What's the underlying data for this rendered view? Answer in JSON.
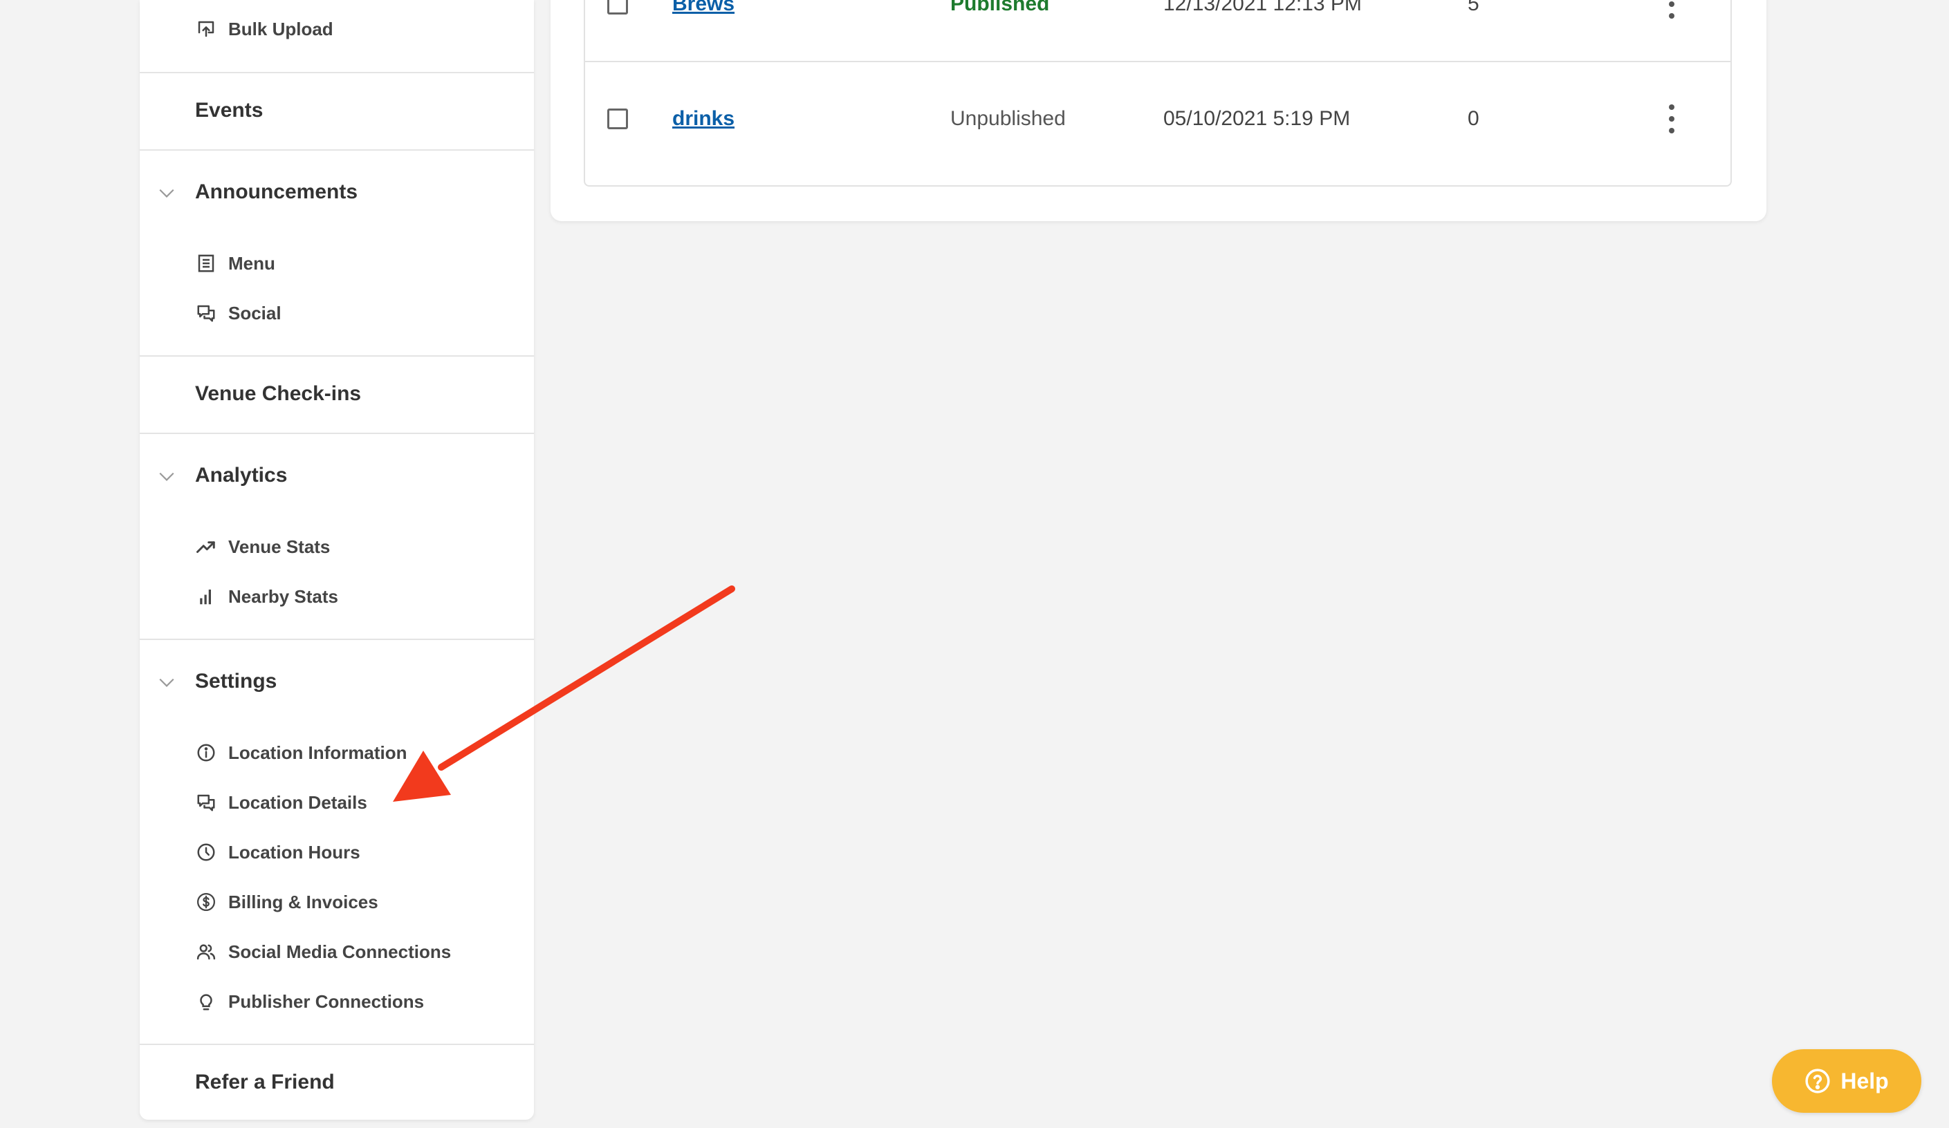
{
  "sidebar": {
    "bulk_upload": {
      "label": "Bulk Upload",
      "icon": "upload-icon"
    },
    "events": {
      "label": "Events"
    },
    "announcements": {
      "label": "Announcements",
      "items": [
        {
          "label": "Menu",
          "icon": "menu-list-icon"
        },
        {
          "label": "Social",
          "icon": "chat-icon"
        }
      ]
    },
    "venue_checkins": {
      "label": "Venue Check-ins"
    },
    "analytics": {
      "label": "Analytics",
      "items": [
        {
          "label": "Venue Stats",
          "icon": "trending-up-icon"
        },
        {
          "label": "Nearby Stats",
          "icon": "bar-chart-icon"
        }
      ]
    },
    "settings": {
      "label": "Settings",
      "items": [
        {
          "label": "Location Information",
          "icon": "info-icon"
        },
        {
          "label": "Location Details",
          "icon": "chat-icon"
        },
        {
          "label": "Location Hours",
          "icon": "clock-icon"
        },
        {
          "label": "Billing & Invoices",
          "icon": "dollar-icon"
        },
        {
          "label": "Social Media Connections",
          "icon": "users-icon"
        },
        {
          "label": "Publisher Connections",
          "icon": "lightbulb-icon"
        }
      ]
    },
    "refer": {
      "label": "Refer a Friend"
    }
  },
  "table": {
    "rows": [
      {
        "name": "Brews",
        "status": "Published",
        "date": "12/13/2021 12:13 PM",
        "count": "5"
      },
      {
        "name": "drinks",
        "status": "Unpublished",
        "date": "05/10/2021 5:19 PM",
        "count": "0"
      }
    ]
  },
  "help": {
    "label": "Help"
  },
  "colors": {
    "link": "#0b5fa8",
    "published": "#1e7b2e",
    "help_button": "#f7b730",
    "annotation_arrow": "#f23a1d"
  }
}
